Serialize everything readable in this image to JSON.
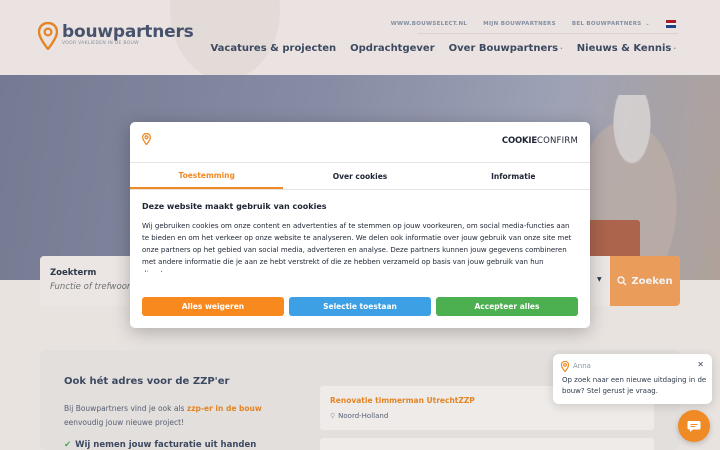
{
  "colors": {
    "brand_orange": "#f08a24",
    "button_orange": "#f7a35c",
    "button_blue": "#3ea0e4",
    "button_green": "#4caf50",
    "nav_text": "#3f4b63"
  },
  "logo": {
    "name": "bouwpartners",
    "tagline": "VOOR VAKLIEDEN IN DE BOUW",
    "icon": "location-pin-icon"
  },
  "topnav": {
    "links": [
      "WWW.BOUWSELECT.NL",
      "MIJN BOUWPARTNERS",
      "BEL BOUWPARTNERS"
    ],
    "language_flag": "dutch-flag-icon"
  },
  "mainnav": {
    "items": [
      "Vacatures & projecten",
      "Opdrachtgever",
      "Over Bouwpartners",
      "Nieuws & Kennis"
    ]
  },
  "search": {
    "label": "Zoekterm",
    "placeholder": "Functie of trefwoord...",
    "button": "Zoeken"
  },
  "lower": {
    "title": "Ook hét adres voor de ZZP'er",
    "text_prefix": "Bij Bouwpartners vind je ook als ",
    "text_highlight": "zzp-er in de bouw",
    "text_suffix": " eenvoudig jouw nieuwe project!",
    "check_item": "Wij nemen jouw facturatie uit handen",
    "job": {
      "title": "Renovatie timmerman Utrecht",
      "badge": "ZZP",
      "location": "Noord-Holland"
    }
  },
  "cookie": {
    "brand_bold": "COOKIE",
    "brand_thin": "CONFIRM",
    "tabs": [
      "Toestemming",
      "Over cookies",
      "Informatie"
    ],
    "active_tab": "Toestemming",
    "heading": "Deze website maakt gebruik van cookies",
    "body": "Wij gebruiken cookies om onze content en advertenties af te stemmen op jouw voorkeuren, om social media-functies aan te bieden en om het verkeer op onze website te analyseren. We delen ook informatie over jouw gebruik van onze site met onze partners op het gebied van social media, adverteren en analyse. Deze partners kunnen jouw gegevens combineren met andere informatie die je aan ze hebt verstrekt of die ze hebben verzameld op basis van jouw gebruik van hun diensten.",
    "buttons": {
      "reject": "Alles weigeren",
      "selection": "Selectie toestaan",
      "accept": "Accepteer alles"
    }
  },
  "chat": {
    "agent_name": "Anna",
    "message": "Op zoek naar een nieuwe uitdaging in de bouw? Stel gerust je vraag.",
    "close_icon": "close-icon",
    "fab_icon": "chat-bubble-icon"
  }
}
